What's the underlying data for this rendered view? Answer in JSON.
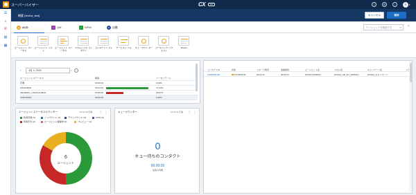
{
  "header": {
    "app_title": "スーパーバイザー",
    "brand": "CX",
    "brand_badge": "one",
    "avatar_initial": "Y",
    "icons": [
      "help-icon",
      "settings-icon",
      "notification-icon"
    ]
  },
  "subheader": {
    "dashboard_name": "概要 (test1a_test)",
    "cancel_label": "キャンセル",
    "save_label": "保存"
  },
  "tabs": [
    {
      "label": "ACD",
      "icon": "acd-icon",
      "active": true
    },
    {
      "label": "QM",
      "icon": "qm-icon",
      "active": false
    },
    {
      "label": "WFM",
      "icon": "wfm-icon",
      "active": false
    },
    {
      "label": "自動",
      "icon": "automation-icon",
      "active": false
    }
  ],
  "search": {
    "placeholder": "ウィジェットを検索する"
  },
  "widgets": [
    {
      "label": "エージェント ステータス"
    },
    {
      "label": "エージェント リスト"
    },
    {
      "label": "エージェント ステータス"
    },
    {
      "label": "スキルごとの コンタクト"
    },
    {
      "label": "コンタクトリ スト"
    },
    {
      "label": "サービスレ ベル"
    },
    {
      "label": "キューカウン ター"
    },
    {
      "label": "コールバック リクエスト"
    },
    {
      "label": "Report"
    }
  ],
  "agent_list": {
    "date": "4月 4, 2024",
    "columns": [
      "エージェントステータス",
      "期間",
      "パーセンテージ"
    ],
    "rows": [
      {
        "status": "不明",
        "duration": "00:00:00",
        "percent": "0.00%",
        "bar": 0.0,
        "color": "#2a9a3a"
      },
      {
        "status": "AVAILABLE",
        "duration": "00:24:03",
        "percent": "71.03%",
        "bar": 0.7103,
        "color": "#2a9a3a"
      },
      {
        "status": "GENERAL_UNAVAILABLE",
        "duration": "00:09:48",
        "percent": "28.97%",
        "bar": 0.2897,
        "color": "#c62828"
      },
      {
        "status": "UNKNOWN",
        "duration": "00:00:00",
        "percent": "0.00%",
        "bar": 0.0,
        "color": "#2a9a3a"
      }
    ]
  },
  "agent_status_counter": {
    "title": "エージェントステータスカウンター",
    "meta": "10:11:16 午後",
    "total": "6",
    "total_label": "エージェント",
    "legend": [
      {
        "label": "利用可能 (3)",
        "color": "#2a9a3a"
      },
      {
        "label": "インバウンド (0)",
        "color": "#1c6dc4"
      },
      {
        "label": "アウトバウンド (0)",
        "color": "#2f4f8f"
      },
      {
        "label": "ACW (0)",
        "color": "#6a3fa0"
      },
      {
        "label": "利用不可 (2)",
        "color": "#c62828"
      },
      {
        "label": "エージェント保留中 (0)",
        "color": "#e05a8a"
      },
      {
        "label": "プレビュー (1)",
        "color": "#e8b020"
      }
    ],
    "chart_data": {
      "type": "pie",
      "categories": [
        "利用可能",
        "インバウンド",
        "アウトバウンド",
        "ACW",
        "利用不可",
        "エージェント保留中",
        "プレビュー"
      ],
      "values": [
        3,
        0,
        0,
        0,
        2,
        0,
        1
      ],
      "colors": [
        "#2a9a3a",
        "#1c6dc4",
        "#2f4f8f",
        "#6a3fa0",
        "#c62828",
        "#e05a8a",
        "#e8b020"
      ]
    }
  },
  "queue_counter": {
    "title": "キューカウンター",
    "meta": "10:11:11 午後",
    "count": "0",
    "caption": "キュー待ちのコンタクト",
    "time": "00:00:00",
    "time_caption": "最長の待機"
  },
  "contact_list": {
    "columns": [
      "コンタクトID",
      "状態",
      "スタート時刻",
      "連絡時間",
      "エージェント名",
      "スキル名",
      "キャンペーン名",
      "メデ"
    ],
    "rows": [
      {
        "id": "1999022079a",
        "state": "OUTBOUND",
        "start": "00:00:13",
        "duration": "00:00:13",
        "agent": "9c4014,(620623)",
        "skill": "9c4014_OB_SU_2028091...",
        "campaign": "9c4014_キャンペーン",
        "media": ""
      }
    ]
  }
}
